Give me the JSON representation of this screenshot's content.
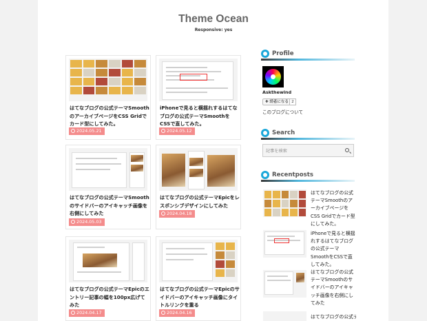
{
  "site": {
    "title": "Theme Ocean",
    "subtitle": "Responsive: yes"
  },
  "posts": [
    {
      "title": "はてなブログの公式テーマSmoothのアーカイブページをCSS Gridでカード型にしてみた。",
      "date": "2024.05.21"
    },
    {
      "title": "iPhoneで見ると横揺れするはてなブログの公式テーマSmoothをCSSで直してみた。",
      "date": "2024.05.12"
    },
    {
      "title": "はてなブログの公式テーマSmoothのサイドバーのアイキャッチ画像を右側にしてみた",
      "date": "2024.05.03"
    },
    {
      "title": "はてなブログの公式テーマEpicをレスポンシブデザインにしてみた",
      "date": "2024.04.18"
    },
    {
      "title": "はてなブログの公式テーマEpicのエントリー記事の幅を100px広げてみた",
      "date": "2024.04.17"
    },
    {
      "title": "はてなブログの公式テーマEpicのサイドバーのアイキャッチ画像にタイトルリンクを重る",
      "date": "2024.04.16"
    }
  ],
  "sidebar": {
    "profile": {
      "heading": "Profile",
      "name": "Askthewind",
      "reader_button": "✚ 読者になる",
      "reader_count": "2",
      "about_link": "このブログについて"
    },
    "search": {
      "heading": "Search",
      "placeholder": "記事を検索"
    },
    "recent": {
      "heading": "Recentposts",
      "items": [
        {
          "title": "はてなブログの公式テーマSmoothのアーカイブページをCSS Gridでカード型にしてみた。"
        },
        {
          "title": "iPhoneで見ると横揺れするはてなブログの公式テーマSmoothをCSSで直してみた。"
        },
        {
          "title": "はてなブログの公式テーマSmoothのサイドバーのアイキャッチ画像を右側にしてみた"
        },
        {
          "title": "はてなブログの公式テーマEpic"
        }
      ]
    }
  },
  "colors": {
    "accent": "#1aa7d9",
    "date_badge": "#f48c8c",
    "title_gray": "#666666"
  }
}
